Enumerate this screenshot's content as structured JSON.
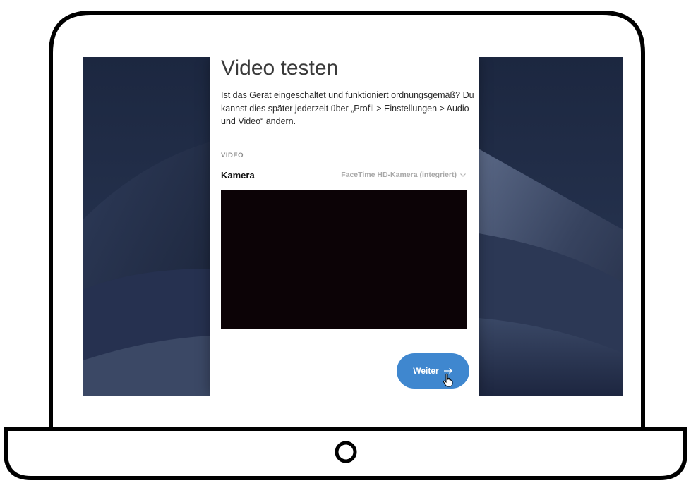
{
  "dialog": {
    "title": "Video testen",
    "description": "Ist das Gerät eingeschaltet und funktioniert ordnungsgemäß? Du kannst dies später jederzeit über „Profil > Einstellungen > Audio und Video“ ändern.",
    "section_label": "VIDEO",
    "camera_label": "Kamera",
    "camera_selected": "FaceTime HD-Kamera (integriert)",
    "next_button_label": "Weiter"
  },
  "icons": {
    "dropdown": "chevron-down-icon",
    "next": "arrow-right-icon",
    "pointer": "hand-pointer-icon"
  },
  "colors": {
    "button": "#3f87cf",
    "video_background": "#0c0306",
    "wallpaper": "#1f2b44",
    "dialog_background": "#ffffff"
  }
}
